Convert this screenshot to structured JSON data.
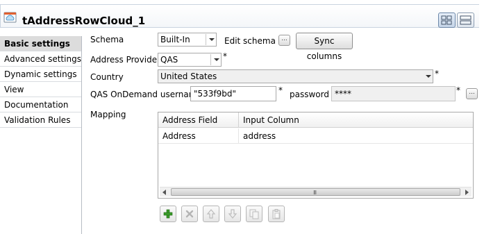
{
  "header": {
    "title": "tAddressRowCloud_1",
    "component_icon": "cloud-component-icon",
    "view_buttons": [
      "grid-view-icon",
      "list-view-icon"
    ]
  },
  "sidebar": {
    "items": [
      {
        "label": "Basic settings",
        "active": true
      },
      {
        "label": "Advanced settings",
        "active": false
      },
      {
        "label": "Dynamic settings",
        "active": false
      },
      {
        "label": "View",
        "active": false
      },
      {
        "label": "Documentation",
        "active": false
      },
      {
        "label": "Validation Rules",
        "active": false
      }
    ]
  },
  "form": {
    "schema_label": "Schema",
    "schema_value": "Built-In",
    "edit_schema_label": "Edit schema",
    "edit_schema_button": "...",
    "sync_columns_button": "Sync columns",
    "address_provider_label": "Address Provider",
    "address_provider_value": "QAS",
    "required_mark": "*",
    "country_label": "Country",
    "country_value": "United States",
    "username_label": "QAS OnDemand username",
    "username_value": "\"533f9bd\"",
    "password_label": "password",
    "password_value": "****",
    "password_button": "...",
    "mapping_label": "Mapping"
  },
  "mapping_table": {
    "columns": [
      "Address Field",
      "Input Column"
    ],
    "rows": [
      {
        "address_field": "Address",
        "input_column": "address"
      }
    ],
    "scrollbar_grip": "III"
  },
  "toolbar": {
    "buttons": [
      "add-icon",
      "remove-icon",
      "move-up-icon",
      "move-down-icon",
      "copy-icon",
      "paste-icon"
    ]
  },
  "colors": {
    "accent_border": "#c9d3df",
    "add_green": "#3a9a2a",
    "sidebar_active": "#dcdcdc"
  }
}
